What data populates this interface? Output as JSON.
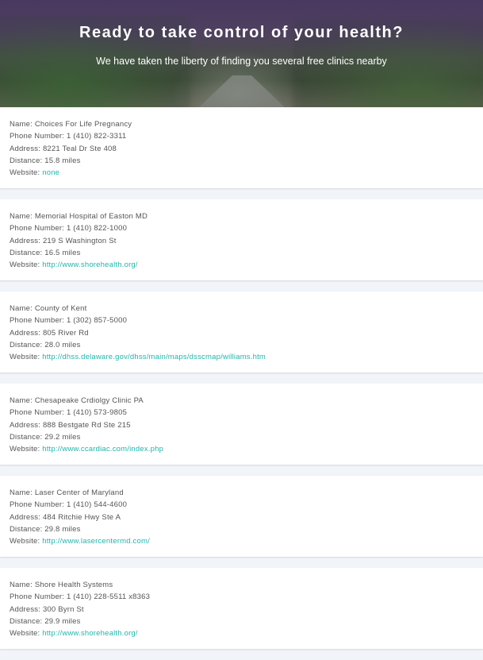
{
  "hero": {
    "title": "Ready to take control of your health?",
    "subtitle": "We have taken the liberty of finding you several free clinics nearby"
  },
  "labels": {
    "name": "Name: ",
    "phone": "Phone Number: ",
    "address": "Address: ",
    "distance": "Distance: ",
    "website": "Website: "
  },
  "clinics": [
    {
      "name": "Choices For Life Pregnancy",
      "phone": "1 (410) 822-3311",
      "address": "8221 Teal Dr Ste 408",
      "distance": "15.8 miles",
      "website": "none"
    },
    {
      "name": "Memorial Hospital of Easton MD",
      "phone": "1 (410) 822-1000",
      "address": "219 S Washington St",
      "distance": "16.5 miles",
      "website": "http://www.shorehealth.org/"
    },
    {
      "name": "County of Kent",
      "phone": "1 (302) 857-5000",
      "address": "805 River Rd",
      "distance": "28.0 miles",
      "website": "http://dhss.delaware.gov/dhss/main/maps/dsscmap/williams.htm"
    },
    {
      "name": "Chesapeake Crdiolgy Clinic PA",
      "phone": "1 (410) 573-9805",
      "address": "888 Bestgate Rd Ste 215",
      "distance": "29.2 miles",
      "website": "http://www.ccardiac.com/index.php"
    },
    {
      "name": "Laser Center of Maryland",
      "phone": "1 (410) 544-4600",
      "address": "484 Ritchie Hwy Ste A",
      "distance": "29.8 miles",
      "website": "http://www.lasercentermd.com/"
    },
    {
      "name": "Shore Health Systems",
      "phone": "1 (410) 228-5511 x8363",
      "address": "300 Byrn St",
      "distance": "29.9 miles",
      "website": "http://www.shorehealth.org/"
    }
  ]
}
